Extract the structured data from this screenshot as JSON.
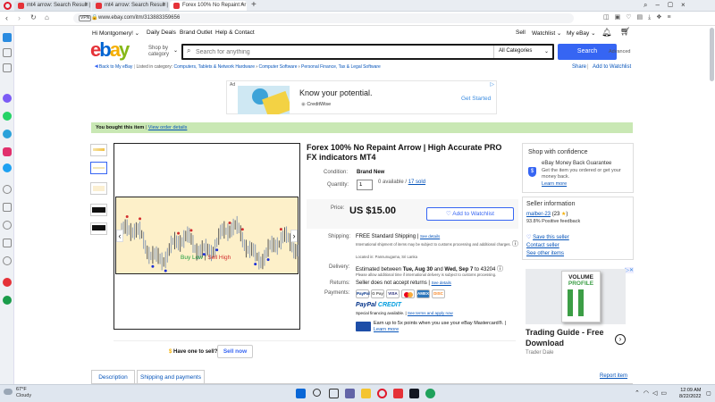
{
  "browser": {
    "tabs": [
      {
        "label": "mt4 arrow: Search Result |",
        "active": false
      },
      {
        "label": "mt4 arrow: Search Result |",
        "active": false
      },
      {
        "label": "Forex 100% No Repaint Ar",
        "active": true
      }
    ],
    "new_tab": "+",
    "url": "www.ebay.com/itm/313883359656",
    "vpn": "VPN"
  },
  "ebay": {
    "greeting": "Hi Montgomery!",
    "deals": "Daily Deals",
    "outlet": "Brand Outlet",
    "help": "Help & Contact",
    "sell": "Sell",
    "watchlist": "Watchlist",
    "myebay": "My eBay",
    "shop_by": "Shop by",
    "category": "category",
    "search_placeholder": "Search for anything",
    "all_categories": "All Categories",
    "search_btn": "Search",
    "advanced": "Advanced"
  },
  "breadcrumb": {
    "back": "Back to My eBay",
    "listed": "Listed in category:",
    "crumbs": [
      "Computers, Tablets & Network Hardware",
      "Computer Software",
      "Personal Finance, Tax & Legal Software"
    ],
    "share": "Share",
    "add_watch": "Add to Watchlist"
  },
  "ad": {
    "ad_label": "Ad",
    "headline": "Know your potential.",
    "brand": "CreditWise",
    "cta": "Get Started"
  },
  "purchased": {
    "text": "You bought this item",
    "link": "View order details"
  },
  "gallery": {
    "caption_buy": "Buy Low",
    "caption_sep": " | ",
    "caption_sell": "Sell High",
    "prev": "‹",
    "next": "›"
  },
  "item": {
    "title": "Forex 100% No Repaint Arrow | High Accurate PRO FX indicators MT4",
    "condition_label": "Condition:",
    "condition": "Brand New",
    "quantity_label": "Quantity:",
    "quantity": "1",
    "available": "0 available / ",
    "sold": "17 sold",
    "price_label": "Price:",
    "price": "US $15.00",
    "add_watch": "Add to Watchlist",
    "shipping_label": "Shipping:",
    "shipping": "FREE Standard Shipping | ",
    "see_details": "See details",
    "ship_note": "International shipment of items may be subject to customs processing and additional charges.",
    "located": "Located in: Pannunugama, Sri Lanka",
    "delivery_label": "Delivery:",
    "delivery_pre": "Estimated between ",
    "delivery_d1": "Tue, Aug 30",
    "delivery_and": " and ",
    "delivery_d2": "Wed, Sep 7",
    "delivery_post": " to 43204",
    "delivery_note": "Please allow additional time if international delivery is subject to customs processing.",
    "returns_label": "Returns:",
    "returns": "Seller does not accept returns | ",
    "returns_details": "See details",
    "payments_label": "Payments:",
    "pay_icons": [
      "PayPal",
      "G Pay",
      "VISA",
      "MC",
      "AMEX",
      "DISC"
    ],
    "paypal_credit_1": "PayPal",
    "paypal_credit_2": "CREDIT",
    "special_fin": "Special financing available. | ",
    "see_terms": "See terms and apply now",
    "mastercard_1": "Earn up to 5x points when you use your eBay Mastercard®. |",
    "learn_more": "Learn more"
  },
  "sell_one": {
    "text": "Have one to sell?",
    "btn": "Sell now"
  },
  "confidence": {
    "heading": "Shop with confidence",
    "guarantee_title": "eBay Money Back Guarantee",
    "guarantee_text": "Get the item you ordered or get your money back.",
    "learn_more": "Learn more"
  },
  "seller": {
    "heading": "Seller information",
    "name": "malber-23",
    "feedback": "(23",
    "feedback_close": ")",
    "positive": "93.8% Positive feedback",
    "save": "Save this seller",
    "contact": "Contact seller",
    "other": "See other items"
  },
  "side_ad": {
    "book1": "VOLUME",
    "book2": "PROFILE",
    "title1": "Trading Guide - Free",
    "title2": "Download",
    "source": "Trader Dale"
  },
  "tabs": {
    "description": "Description",
    "shipping": "Shipping and payments",
    "report": "Report item"
  },
  "taskbar": {
    "temp": "67°F",
    "weather": "Cloudy",
    "time": "12:09 AM",
    "date": "8/22/2022"
  },
  "colors": {
    "ebay_blue": "#3665f3",
    "link": "#0654ba",
    "green_banner": "#c9e8b4",
    "red": "#e53238",
    "yellow": "#f5af02",
    "green": "#86b817"
  }
}
